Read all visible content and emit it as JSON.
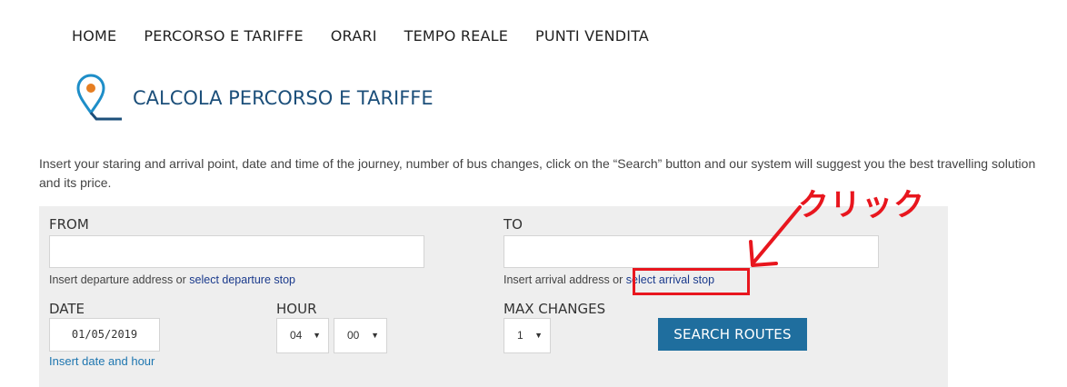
{
  "nav": {
    "items": [
      {
        "label": "HOME"
      },
      {
        "label": "PERCORSO E TARIFFE"
      },
      {
        "label": "ORARI"
      },
      {
        "label": "TEMPO REALE"
      },
      {
        "label": "PUNTI VENDITA"
      }
    ]
  },
  "page": {
    "title": "CALCOLA PERCORSO E TARIFFE",
    "intro": "Insert your staring and arrival point, date and time of the journey, number of bus changes, click on the “Search” button and our system will suggest you the best travelling solution and its price."
  },
  "form": {
    "from_label": "FROM",
    "from_value": "",
    "from_hint": "Insert departure address or",
    "from_link": "select departure stop",
    "to_label": "TO",
    "to_value": "",
    "to_hint": "Insert arrival address or",
    "to_link": "select arrival stop",
    "date_label": "DATE",
    "date_value": "01/05/2019",
    "date_link": "Insert date and hour",
    "hour_label": "HOUR",
    "hour_value": "04",
    "minute_value": "00",
    "max_changes_label": "MAX CHANGES",
    "max_changes_value": "1",
    "search_button": "SEARCH ROUTES"
  },
  "annotation": {
    "text": "クリック",
    "color": "#e8161e"
  },
  "colors": {
    "brand": "#1c4f7a",
    "button": "#1f6e9e",
    "link": "#1a3a8c",
    "accent_pin": "#e67e22"
  },
  "icons": {
    "logo": "map-pin-route-icon",
    "dropdown": "chevron-down-icon"
  }
}
